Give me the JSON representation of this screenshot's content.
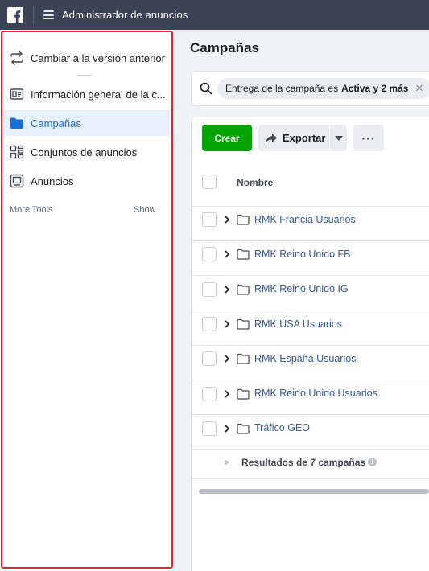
{
  "topbar": {
    "logo_icon": "facebook-logo-icon",
    "menu_icon": "hamburger-menu-icon",
    "title": "Administrador de anuncios"
  },
  "sidebar": {
    "items": [
      {
        "label": "Cambiar a la versión anterior",
        "icon": "switch-arrows-icon",
        "active": false
      },
      {
        "label": "Información general de la c...",
        "icon": "account-overview-icon",
        "active": false
      },
      {
        "label": "Campañas",
        "icon": "folder-icon",
        "active": true
      },
      {
        "label": "Conjuntos de anuncios",
        "icon": "grid-icon",
        "active": false
      },
      {
        "label": "Anuncios",
        "icon": "ad-monitor-icon",
        "active": false
      }
    ],
    "more_tools_label": "More Tools",
    "show_label": "Show"
  },
  "main": {
    "title": "Campañas",
    "search": {
      "filter_prefix": "Entrega de la campaña es",
      "filter_value": "Activa y 2 más",
      "close_glyph": "✕"
    },
    "toolbar": {
      "create_label": "Crear",
      "export_label": "Exportar",
      "more_label": "···"
    },
    "table": {
      "name_header": "Nombre",
      "rows": [
        "RMK Francia Usuarios",
        "RMK Reino Unido FB",
        "RMK Reino Unido IG",
        "RMK USA Usuarios",
        "RMK España Usuarios",
        "RMK Reino Unido Usuarios",
        "Tráfico GEO"
      ],
      "results_label": "Resultados de 7 campañas",
      "info_glyph": "i"
    }
  },
  "colors": {
    "topbar": "#3b4457",
    "accent_blue": "#1a6ed8",
    "link_blue": "#385898",
    "create_green": "#00a400",
    "highlight_red": "#e8232e"
  }
}
